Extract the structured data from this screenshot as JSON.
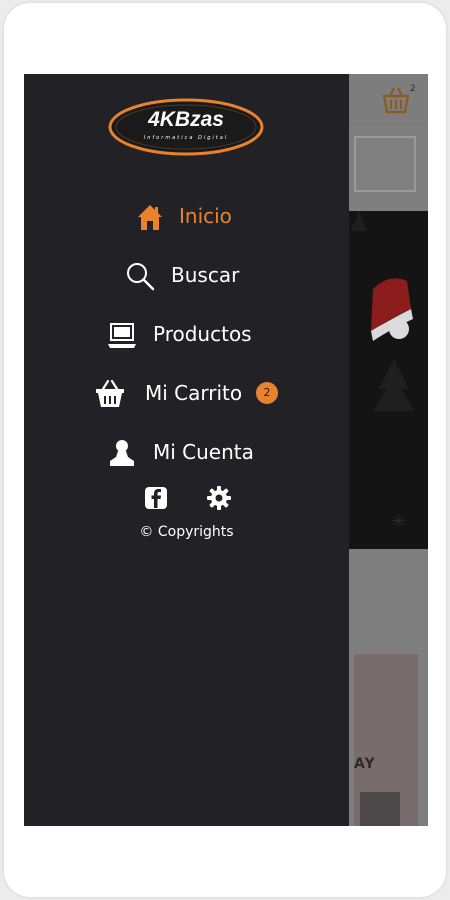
{
  "colors": {
    "accent": "#e8822c",
    "drawer_bg": "#222226",
    "text": "#ffffff"
  },
  "brand": {
    "logo_text": "4KBzas",
    "logo_subtitle": "Informatica Digital"
  },
  "menu": {
    "items": [
      {
        "label": "Inicio",
        "icon": "home-icon",
        "active": true
      },
      {
        "label": "Buscar",
        "icon": "search-icon",
        "active": false
      },
      {
        "label": "Productos",
        "icon": "laptop-icon",
        "active": false
      },
      {
        "label": "Mi Carrito",
        "icon": "basket-icon",
        "active": false,
        "badge": "2"
      },
      {
        "label": "Mi Cuenta",
        "icon": "user-icon",
        "active": false
      }
    ]
  },
  "social": {
    "facebook_icon": "facebook-icon",
    "settings_icon": "gear-icon"
  },
  "footer": {
    "copyright": "© Copyrights"
  },
  "background_app": {
    "cart_count": "2",
    "promo_text": "AY"
  }
}
